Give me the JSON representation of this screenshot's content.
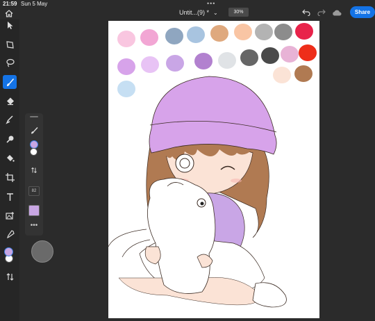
{
  "status": {
    "time": "21:59",
    "date": "Sun 5 May",
    "dots": "•••"
  },
  "document": {
    "title": "Untit...(9) *",
    "chevron": "⌄",
    "zoom": "30%"
  },
  "toolbar": {
    "share_label": "Share",
    "undo_icon": "undo-icon",
    "redo_icon": "redo-icon",
    "cloud_icon": "cloud-icon"
  },
  "left_tools": [
    {
      "name": "home",
      "icon": "home-icon"
    },
    {
      "name": "move",
      "icon": "arrow-cursor-icon"
    },
    {
      "name": "transform",
      "icon": "transform-icon"
    },
    {
      "name": "lasso",
      "icon": "lasso-icon"
    },
    {
      "name": "brush",
      "icon": "brush-icon",
      "active": true
    },
    {
      "name": "eraser",
      "icon": "eraser-icon"
    },
    {
      "name": "smudge",
      "icon": "smudge-icon"
    },
    {
      "name": "clone",
      "icon": "clone-stamp-icon"
    },
    {
      "name": "fill",
      "icon": "paint-bucket-icon"
    },
    {
      "name": "crop",
      "icon": "crop-icon"
    },
    {
      "name": "type",
      "icon": "type-icon"
    },
    {
      "name": "place-image",
      "icon": "place-image-icon"
    },
    {
      "name": "eyedropper",
      "icon": "eyedropper-icon"
    },
    {
      "name": "swap",
      "icon": "swap-arrows-icon"
    }
  ],
  "colors": {
    "foreground": "#c8a6e3",
    "background": "#ffffff",
    "accent": "#1473e6"
  },
  "brush_panel": {
    "size": "82",
    "more": "•••"
  },
  "palette": [
    "#f9c6e0",
    "#f2a6d4",
    "#8fa6c0",
    "#a8c4e0",
    "#dfa97e",
    "#f9c5a4",
    "#b3b3b3",
    "#8c8c8c",
    "#e8234a",
    "#d7a3ea",
    "#e8c3f5",
    "#c9a6e6",
    "#b281cf",
    "#e0e3e6",
    "#666666",
    "#4a4a4a",
    "#e8b3d6",
    "#ee2e1a",
    "#c6dff3",
    "#fbe3d6",
    "#b07a52"
  ]
}
